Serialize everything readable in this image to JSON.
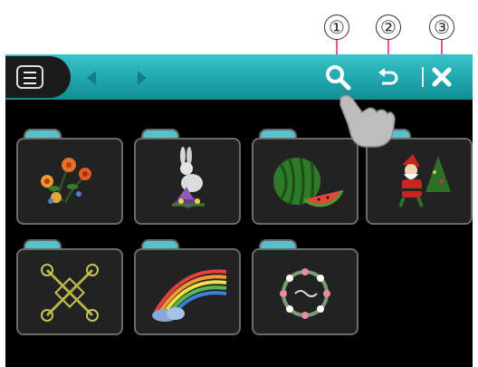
{
  "callouts": [
    "①",
    "②",
    "③"
  ],
  "toolbar": {
    "menu_icon": "menu-icon",
    "back_icon": "left-arrow-icon",
    "forward_icon": "right-arrow-icon",
    "search_icon": "search-icon",
    "undo_icon": "undo-icon",
    "close_icon": "close-icon"
  },
  "folders": [
    {
      "icon": "flowers-design-icon"
    },
    {
      "icon": "rabbit-design-icon"
    },
    {
      "icon": "watermelon-design-icon"
    },
    {
      "icon": "santa-design-icon"
    },
    {
      "icon": "ornament-design-icon"
    },
    {
      "icon": "rainbow-design-icon"
    },
    {
      "icon": "wreath-design-icon"
    }
  ],
  "colors": {
    "accent": "#1fa6ae",
    "callout_line": "#e0559a",
    "background": "#000000"
  }
}
